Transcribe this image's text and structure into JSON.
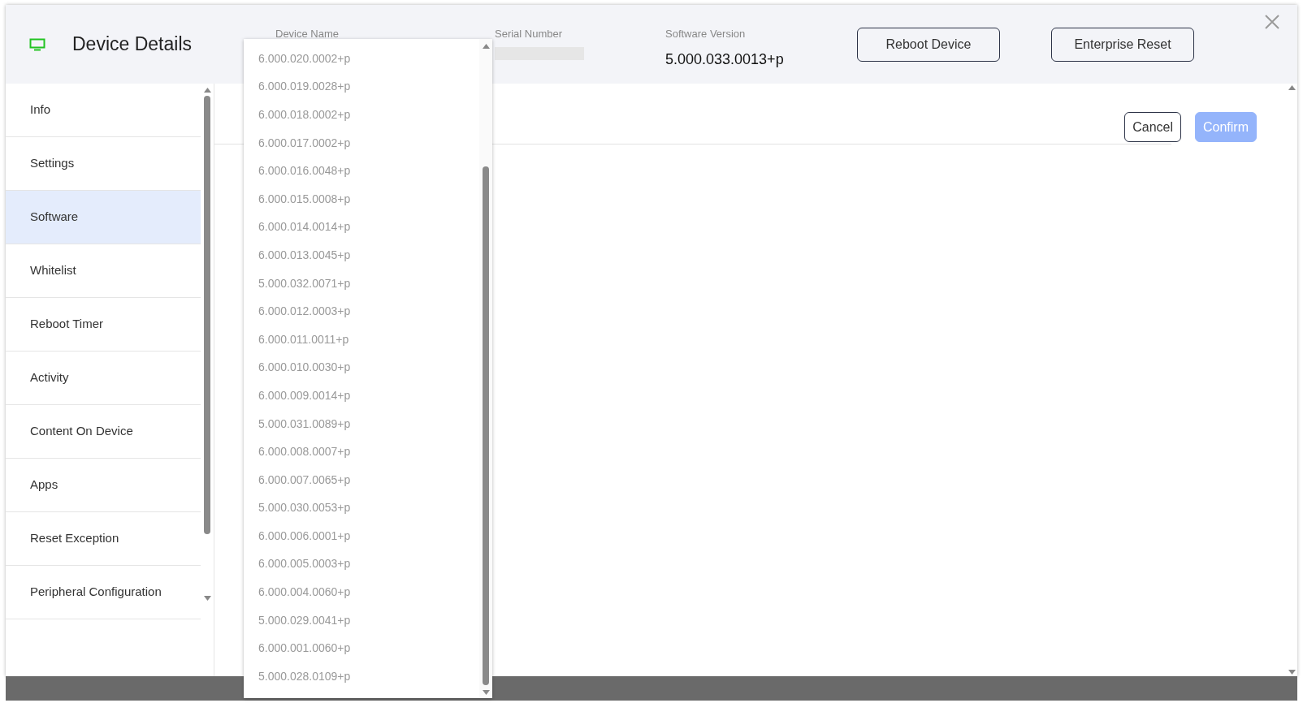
{
  "header": {
    "title": "Device Details",
    "fields": [
      {
        "kind": "text",
        "label": "Device Name"
      },
      {
        "kind": "redacted",
        "label": "Serial Number"
      },
      {
        "kind": "text",
        "label": "Software Version",
        "value": "5.000.033.0013+p"
      }
    ],
    "buttons": [
      "Reboot Device",
      "Enterprise Reset"
    ]
  },
  "sidebar": {
    "items": [
      {
        "label": "Info",
        "selected": false
      },
      {
        "label": "Settings",
        "selected": false
      },
      {
        "label": "Software",
        "selected": true
      },
      {
        "label": "Whitelist",
        "selected": false
      },
      {
        "label": "Reboot Timer",
        "selected": false
      },
      {
        "label": "Activity",
        "selected": false
      },
      {
        "label": "Content On Device",
        "selected": false
      },
      {
        "label": "Apps",
        "selected": false
      },
      {
        "label": "Reset Exception",
        "selected": false
      },
      {
        "label": "Peripheral Configuration",
        "selected": false
      }
    ]
  },
  "actions": [
    {
      "label": "Cancel",
      "disabled": false
    },
    {
      "label": "Confirm",
      "disabled": true
    }
  ],
  "dropdown": {
    "options": [
      "6.000.020.0002+p",
      "6.000.019.0028+p",
      "6.000.018.0002+p",
      "6.000.017.0002+p",
      "6.000.016.0048+p",
      "6.000.015.0008+p",
      "6.000.014.0014+p",
      "6.000.013.0045+p",
      "5.000.032.0071+p",
      "6.000.012.0003+p",
      "6.000.011.0011+p",
      "6.000.010.0030+p",
      "6.000.009.0014+p",
      "5.000.031.0089+p",
      "6.000.008.0007+p",
      "6.000.007.0065+p",
      "5.000.030.0053+p",
      "6.000.006.0001+p",
      "6.000.005.0003+p",
      "6.000.004.0060+p",
      "5.000.029.0041+p",
      "6.000.001.0060+p",
      "5.000.028.0109+p"
    ]
  }
}
